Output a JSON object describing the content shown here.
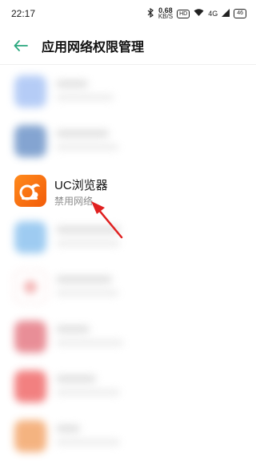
{
  "status_bar": {
    "time": "22:17",
    "speed_value": "0.68",
    "speed_unit": "KB/S",
    "hd_badge": "HD",
    "signal_label": "4G",
    "battery_level": "46"
  },
  "header": {
    "title": "应用网络权限管理",
    "back_icon": "back-arrow-icon",
    "accent_color": "#2aa87e"
  },
  "app_list": {
    "highlighted_app": {
      "name": "UC浏览器",
      "status": "禁用网络",
      "icon": "uc-browser-icon"
    }
  },
  "annotation": {
    "type": "red-arrow",
    "color": "#e02020"
  }
}
